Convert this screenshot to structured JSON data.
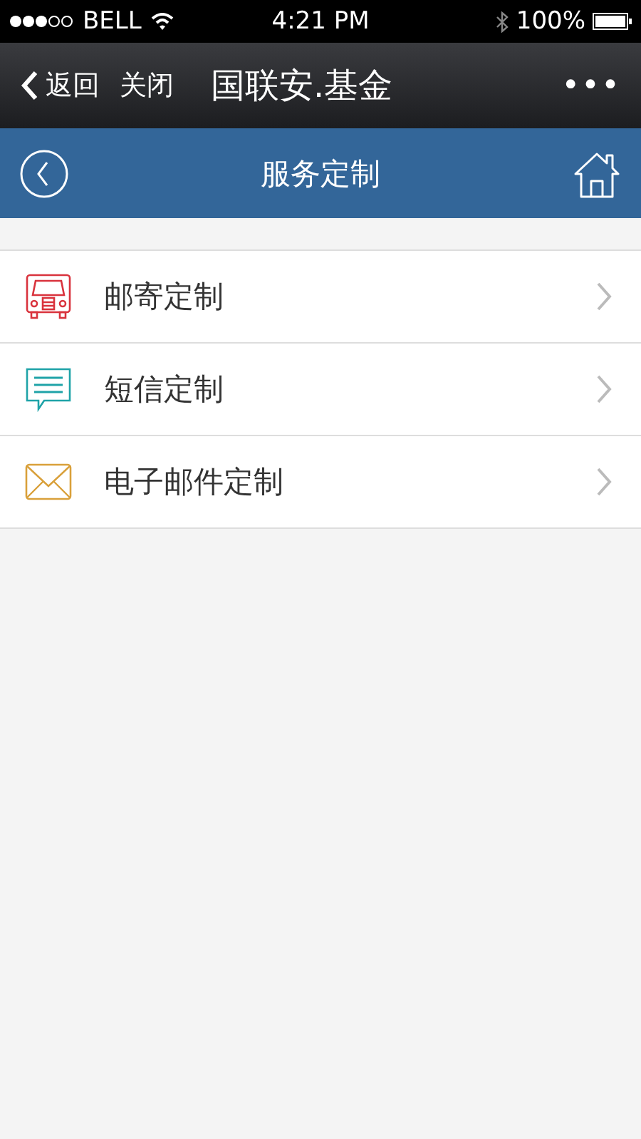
{
  "status_bar": {
    "carrier": "BELL",
    "time": "4:21 PM",
    "battery": "100%"
  },
  "nav_bar": {
    "back": "返回",
    "close": "关闭",
    "title": "国联安.基金",
    "more": "•••"
  },
  "header": {
    "title": "服务定制"
  },
  "items": [
    {
      "label": "邮寄定制",
      "kind": "truck",
      "color": "#d9333d"
    },
    {
      "label": "短信定制",
      "kind": "chat",
      "color": "#1fa3a8"
    },
    {
      "label": "电子邮件定制",
      "kind": "mail",
      "color": "#d9a03a"
    }
  ]
}
